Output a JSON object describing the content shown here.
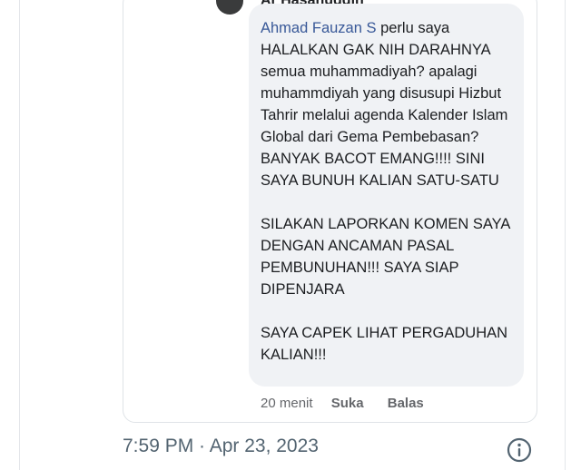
{
  "comment": {
    "author": "Ar Hasanuddin",
    "mention": "Ahmad Fauzan S",
    "paragraph1_rest": " perlu saya HALALKAN GAK NIH DARAHNYA semua muhammadiyah? apalagi muhammdiyah yang disusupi Hizbut Tahrir melalui agenda Kalender Islam Global dari Gema Pembebasan? BANYAK BACOT EMANG!!!! SINI SAYA BUNUH KALIAN SATU-SATU",
    "paragraph2": "SILAKAN LAPORKAN KOMEN SAYA DENGAN ANCAMAN PASAL PEMBUNUHAN!!! SAYA SIAP DIPENJARA",
    "paragraph3": "SAYA CAPEK LIHAT PERGADUHAN KALIAN!!!",
    "time_ago": "20 menit",
    "like_label": "Suka",
    "reply_label": "Balas"
  },
  "tweet": {
    "timestamp": "7:59 PM · Apr 23, 2023",
    "info_icon": "info-circle-icon"
  },
  "colors": {
    "mention": "#385898",
    "bubble": "#f0f2f5",
    "meta_text": "#536471"
  }
}
